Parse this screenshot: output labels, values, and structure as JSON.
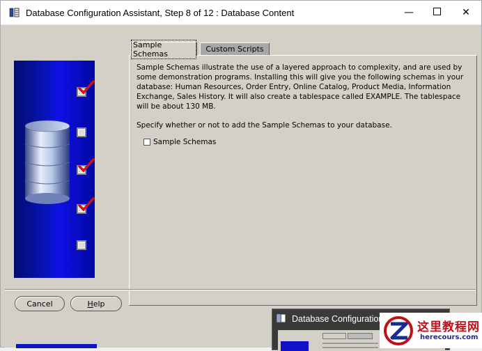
{
  "window": {
    "title": "Database Configuration Assistant, Step 8 of 12 : Database Content",
    "minimize_glyph": "—",
    "maximize_glyph": "☐",
    "close_glyph": "✕"
  },
  "tabs": [
    {
      "label": "Sample Schemas",
      "active": true
    },
    {
      "label": "Custom Scripts",
      "active": false
    }
  ],
  "content": {
    "description": "Sample Schemas illustrate the use of a layered approach to complexity, and are used by some demonstration programs. Installing this will give you the following schemas in your database: Human Resources, Order Entry, Online Catalog, Product Media, Information Exchange, Sales History. It will also create a tablespace called EXAMPLE. The tablespace will be about 130 MB.",
    "specify": "Specify whether or not to add the Sample Schemas to your database.",
    "checkbox_label": "Sample Schemas",
    "checkbox_checked": false
  },
  "buttons": {
    "cancel": "Cancel",
    "help_prefix": "",
    "help_mnemonic": "H",
    "help_rest": "elp"
  },
  "graphic": {
    "step_checks": [
      true,
      false,
      true,
      true,
      false
    ]
  },
  "taskbar_preview": {
    "title": "Database Configuration Assistant",
    "close_glyph": "✕"
  },
  "watermark": {
    "line1": "这里教程网",
    "line2": "herecours.com"
  }
}
